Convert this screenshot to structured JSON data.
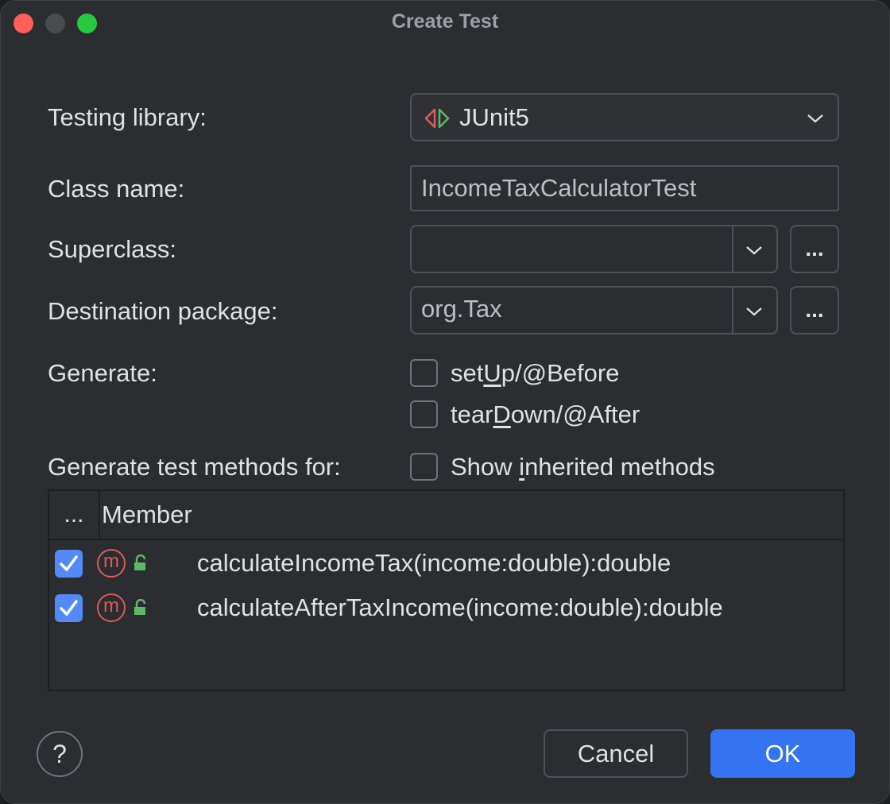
{
  "window": {
    "title": "Create Test"
  },
  "form": {
    "testing_library_label": "Testing library:",
    "testing_library_value": "JUnit5",
    "class_name_label": "Class name:",
    "class_name_value": "IncomeTaxCalculatorTest",
    "superclass_label": "Superclass:",
    "superclass_value": "",
    "destination_package_label": "Destination package:",
    "destination_package_value": "org.Tax",
    "browse_label": "...",
    "generate_label": "Generate:",
    "generate_methods_label": "Generate test methods for:",
    "show_inherited_prefix": "Show ",
    "show_inherited_accel": "i",
    "show_inherited_suffix": "nherited methods"
  },
  "generate_options": [
    {
      "prefix": "set",
      "accel": "U",
      "suffix": "p/@Before",
      "checked": false
    },
    {
      "prefix": "tear",
      "accel": "D",
      "suffix": "own/@After",
      "checked": false
    }
  ],
  "members_table": {
    "col_dots": "...",
    "col_member": "Member",
    "rows": [
      {
        "checked": true,
        "icon": "method-icon",
        "visibility": "public-lock-icon",
        "signature": "calculateIncomeTax(income:double):double"
      },
      {
        "checked": true,
        "icon": "method-icon",
        "visibility": "public-lock-icon",
        "signature": "calculateAfterTaxIncome(income:double):double"
      }
    ]
  },
  "footer": {
    "help_label": "?",
    "cancel_label": "Cancel",
    "ok_label": "OK"
  },
  "colors": {
    "accent": "#3574f0",
    "method_icon": "#db5c5c",
    "lock_icon": "#5fb865",
    "close": "#ff5f57",
    "maximize": "#28c840"
  }
}
